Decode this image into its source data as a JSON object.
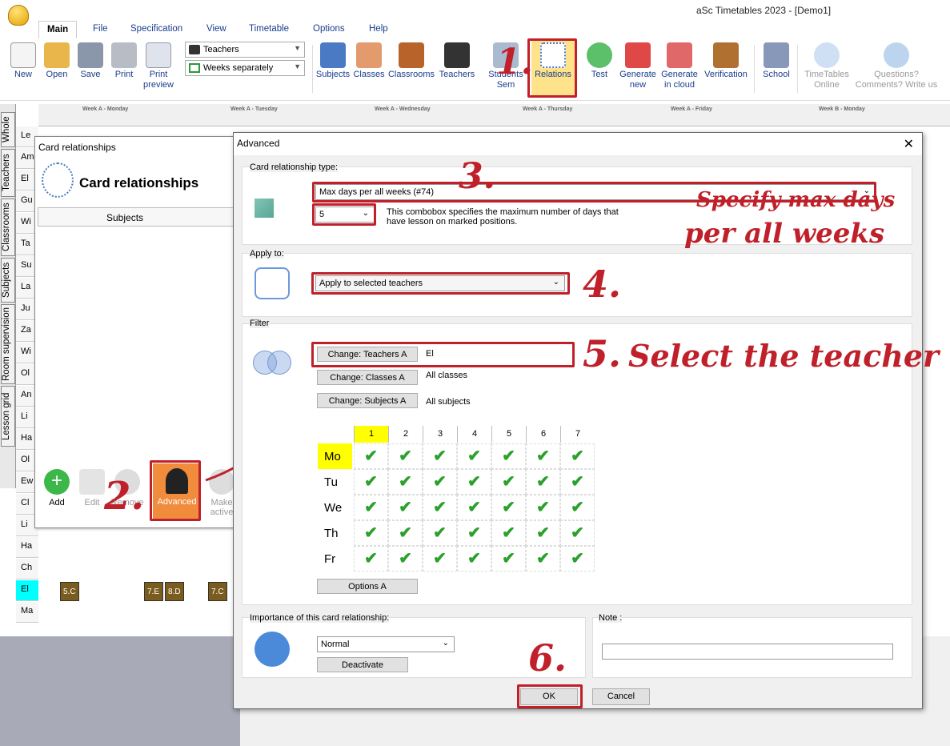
{
  "app": {
    "title": "aSc Timetables 2023  - [Demo1]"
  },
  "menu": {
    "tabs": [
      "Main",
      "File",
      "Specification",
      "View",
      "Timetable",
      "Options",
      "Help"
    ],
    "active": "Main"
  },
  "ribbon": {
    "new": "New",
    "open": "Open",
    "save": "Save",
    "print": "Print",
    "print_preview": "Print preview",
    "view_combo": "Teachers",
    "weeks_combo": "Weeks separately",
    "subjects": "Subjects",
    "classes": "Classes",
    "classrooms": "Classrooms",
    "teachers": "Teachers",
    "students_sem": "Students Sem",
    "relations": "Relations",
    "test": "Test",
    "generate_new": "Generate new",
    "generate_cloud": "Generate in cloud",
    "verification": "Verification",
    "school": "School",
    "timetables_online": "TimeTables Online",
    "questions": "Questions? Comments? Write us"
  },
  "sidetabs": [
    "Whole",
    "Teachers",
    "Classrooms",
    "Subjects",
    "Room supervision",
    "Lesson grid"
  ],
  "rows": [
    "Le",
    "Am",
    "El",
    "Gu",
    "Wi",
    "Ta",
    "Su",
    "La",
    "Ju",
    "Za",
    "Wi",
    "Ol",
    "An",
    "Li",
    "Ha",
    "Ol",
    "Ew",
    "Cl",
    "Li",
    "Ha",
    "Ch",
    "El",
    "Ma"
  ],
  "days_header": [
    "Week A - Monday",
    "Week A - Tuesday",
    "Week A - Wednesday",
    "Week A - Thursday",
    "Week A - Friday",
    "Week B - Monday"
  ],
  "lesson_cells": [
    "5.C",
    "7.E",
    "8.D",
    "7.C"
  ],
  "card_panel": {
    "title": "Card relationships",
    "heading": "Card relationships",
    "col_subjects": "Subjects",
    "add": "Add",
    "edit": "Edit",
    "remove": "Remove",
    "advanced": "Advanced",
    "make_active": "Make active"
  },
  "advanced": {
    "title": "Advanced",
    "type_label": "Card relationship type:",
    "type_value": "Max days per all weeks (#74)",
    "days_value": "5",
    "desc": "This combobox specifies the maximum number of days that have lesson on marked positions.",
    "apply_label": "Apply to:",
    "apply_value": "Apply to selected teachers",
    "filter_label": "Filter",
    "btn_teachers": "Change: Teachers A",
    "teachers_val": "El",
    "btn_classes": "Change: Classes A",
    "classes_val": "All classes",
    "btn_subjects": "Change: Subjects A",
    "subjects_val": "All subjects",
    "periods": [
      "1",
      "2",
      "3",
      "4",
      "5",
      "6",
      "7"
    ],
    "days": [
      "Mo",
      "Tu",
      "We",
      "Th",
      "Fr"
    ],
    "options_btn": "Options A",
    "importance_label": "Importance of this card relationship:",
    "importance_value": "Normal",
    "deactivate": "Deactivate",
    "note_label": "Note :",
    "ok": "OK",
    "cancel": "Cancel"
  },
  "annotations": {
    "n1": "1.",
    "n2": "2.",
    "n3": "3.",
    "n4": "4.",
    "n5": "5.",
    "n5_text": "Select the teacher",
    "n6": "6.",
    "n3_text1": "Specify max days",
    "n3_text2": "per all weeks"
  },
  "colors": {
    "accent_red": "#c0202a",
    "check_green": "#2ca02c",
    "highlight_yellow": "#ffff00",
    "lesson_brown": "#7a5c1e"
  }
}
